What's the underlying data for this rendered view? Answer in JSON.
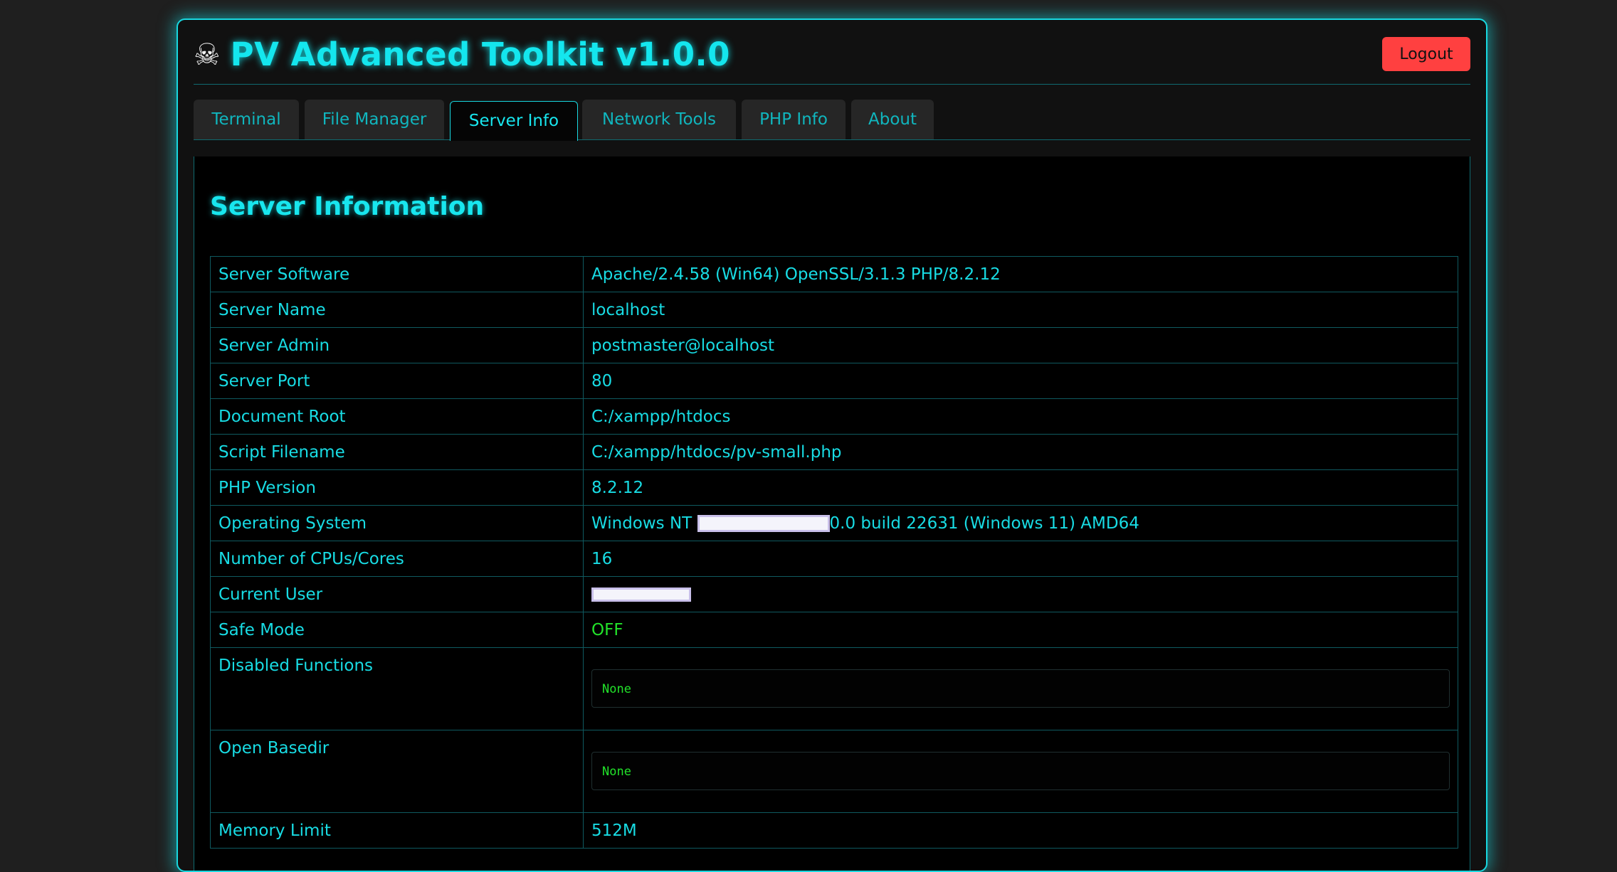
{
  "header": {
    "icon": "skull-icon",
    "title": "PV Advanced Toolkit v1.0.0",
    "logout_label": "Logout"
  },
  "tabs": [
    {
      "label": "Terminal",
      "active": false
    },
    {
      "label": "File Manager",
      "active": false
    },
    {
      "label": "Server Info",
      "active": true
    },
    {
      "label": "Network Tools",
      "active": false
    },
    {
      "label": "PHP Info",
      "active": false
    },
    {
      "label": "About",
      "active": false
    }
  ],
  "panel": {
    "title": "Server Information"
  },
  "rows": {
    "server_software": {
      "label": "Server Software",
      "value": "Apache/2.4.58 (Win64) OpenSSL/3.1.3 PHP/8.2.12"
    },
    "server_name": {
      "label": "Server Name",
      "value": "localhost"
    },
    "server_admin": {
      "label": "Server Admin",
      "value": "postmaster@localhost"
    },
    "server_port": {
      "label": "Server Port",
      "value": "80"
    },
    "document_root": {
      "label": "Document Root",
      "value": "C:/xampp/htdocs"
    },
    "script_filename": {
      "label": "Script Filename",
      "value": "C:/xampp/htdocs/pv-small.php"
    },
    "php_version": {
      "label": "PHP Version",
      "value": "8.2.12"
    },
    "operating_system": {
      "label": "Operating System",
      "value_prefix": "Windows NT",
      "value_suffix": "0.0 build 22631 (Windows 11) AMD64"
    },
    "cpus": {
      "label": "Number of CPUs/Cores",
      "value": "16"
    },
    "current_user": {
      "label": "Current User"
    },
    "safe_mode": {
      "label": "Safe Mode",
      "value": "OFF"
    },
    "disabled_functions": {
      "label": "Disabled Functions",
      "value": "None"
    },
    "open_basedir": {
      "label": "Open Basedir",
      "value": "None"
    },
    "memory_limit": {
      "label": "Memory Limit",
      "value": "512M"
    }
  },
  "colors": {
    "accent": "#14e0e8",
    "background": "#1f1f1f",
    "logout": "#ff4040",
    "status_off": "#22e22a"
  }
}
